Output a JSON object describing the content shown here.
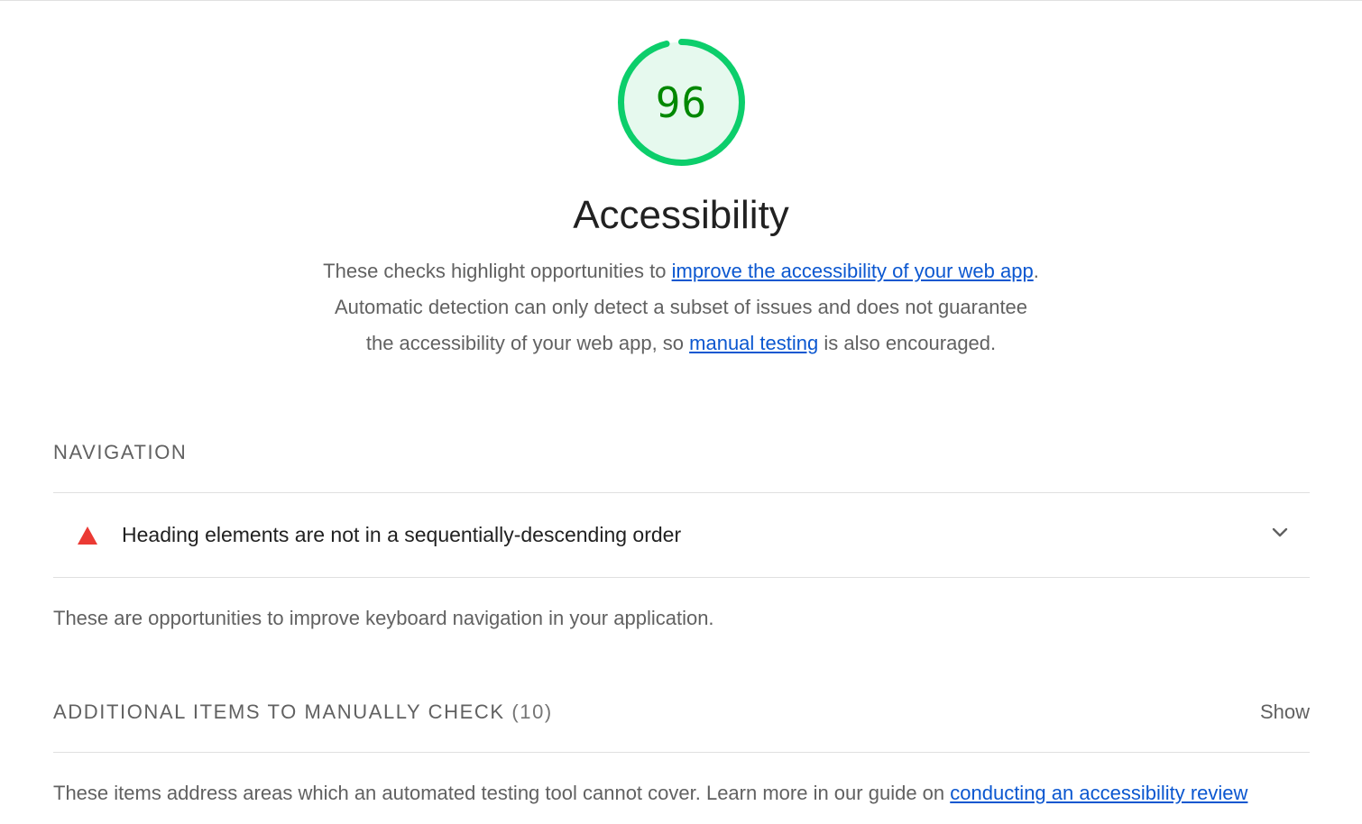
{
  "category": {
    "score": "96",
    "score_fraction": 0.96,
    "title": "Accessibility",
    "description": {
      "part1": "These checks highlight opportunities to ",
      "link1": "improve the accessibility of your web app",
      "part2": ". Automatic detection can only detect a subset of issues and does not guarantee the accessibility of your web app, so ",
      "link2": "manual testing",
      "part3": " is also encouraged."
    }
  },
  "navigation_group": {
    "title": "NAVIGATION",
    "audit": {
      "title": "Heading elements are not in a sequentially-descending order",
      "status": "fail",
      "icon": "warning-triangle-icon"
    },
    "description": "These are opportunities to improve keyboard navigation in your application."
  },
  "manual_group": {
    "title": "ADDITIONAL ITEMS TO MANUALLY CHECK",
    "count": "(10)",
    "toggle_label": "Show",
    "description": "These items address areas which an automated testing tool cannot cover. Learn more in our guide on ",
    "link": "conducting an accessibility review"
  },
  "colors": {
    "pass": "#0cce6b",
    "pass_fill": "#e6f9ee",
    "pass_text": "#008800",
    "fail": "#eb3a34",
    "link": "#0b57d0"
  }
}
